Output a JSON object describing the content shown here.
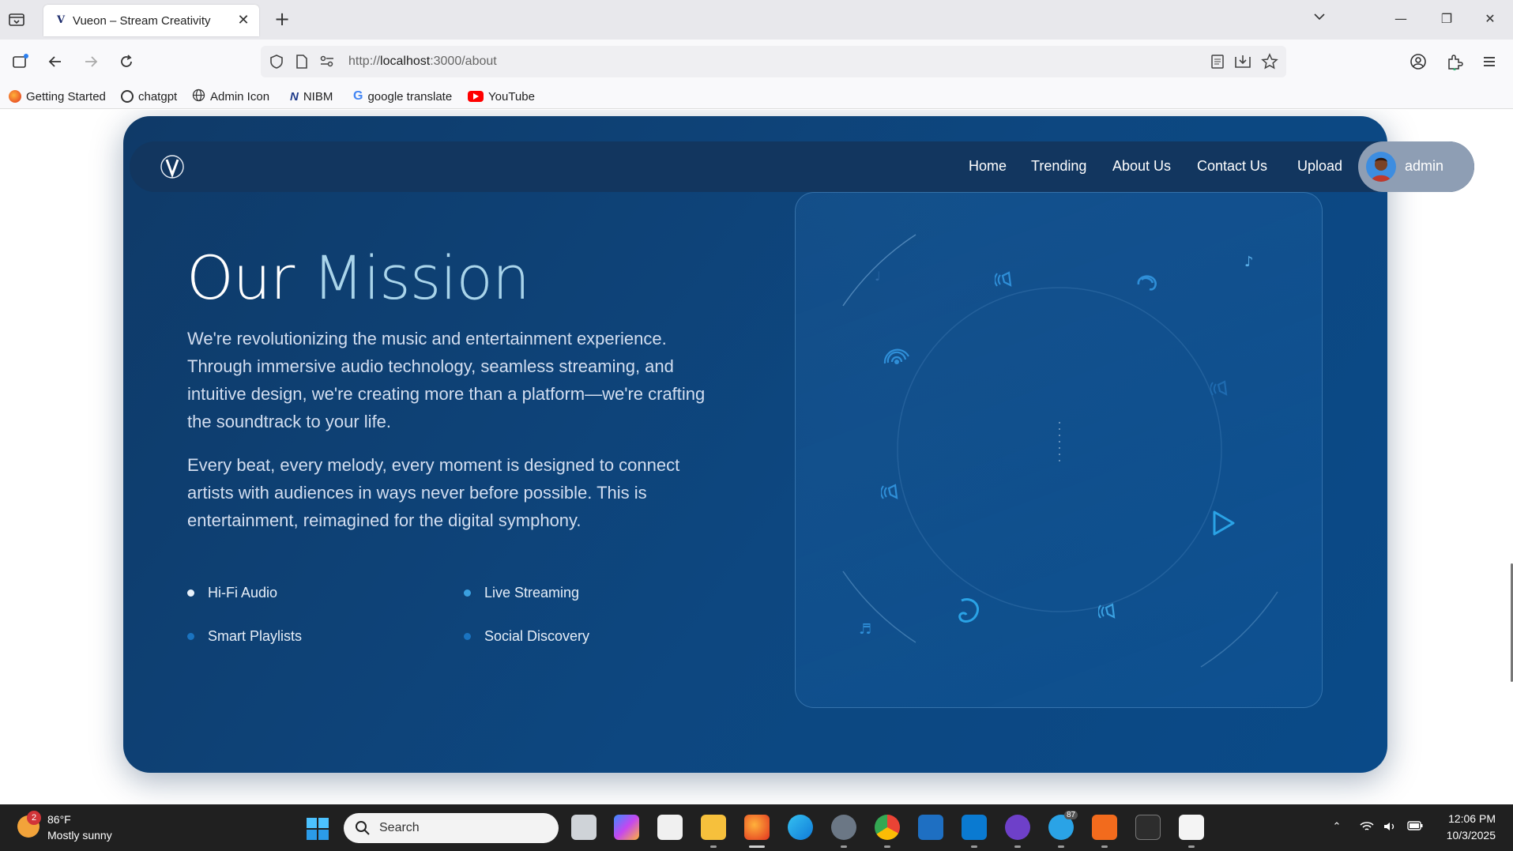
{
  "browser": {
    "tab_title": "Vueon – Stream Creativity",
    "url_prefix": "http://",
    "url_host": "localhost",
    "url_path": ":3000/about",
    "bookmarks": [
      {
        "label": "Getting Started",
        "icon": "firefox-icon"
      },
      {
        "label": "chatgpt",
        "icon": "openai-icon"
      },
      {
        "label": "Admin Icon",
        "icon": "globe-icon"
      },
      {
        "label": "NIBM",
        "icon": "nibm-icon"
      },
      {
        "label": "google translate",
        "icon": "google-icon"
      },
      {
        "label": "YouTube",
        "icon": "youtube-icon"
      }
    ]
  },
  "site": {
    "nav": {
      "home": "Home",
      "trending": "Trending",
      "about": "About Us",
      "contact": "Contact Us",
      "upload": "Upload",
      "user": "admin"
    },
    "mission": {
      "title_part1": "Our",
      "title_part2": "Mission",
      "para1": "We're revolutionizing the music and entertainment experience. Through immersive audio technology, seamless streaming, and intuitive design, we're creating more than a platform—we're crafting the soundtrack to your life.",
      "para2": "Every beat, every melody, every moment is designed to connect artists with audiences in ways never before possible. This is entertainment, reimagined for the digital symphony.",
      "features": [
        "Hi-Fi Audio",
        "Live Streaming",
        "Smart Playlists",
        "Social Discovery"
      ]
    },
    "colors": {
      "hero_bg": "#0d4780",
      "title_accent": "#a9d4ea",
      "icon_blue": "#2f8fd8"
    }
  },
  "taskbar": {
    "weather_badge": "2",
    "temperature": "86°F",
    "condition": "Mostly sunny",
    "search_placeholder": "Search",
    "telegram_badge": "87",
    "time": "12:06 PM",
    "date": "10/3/2025"
  }
}
